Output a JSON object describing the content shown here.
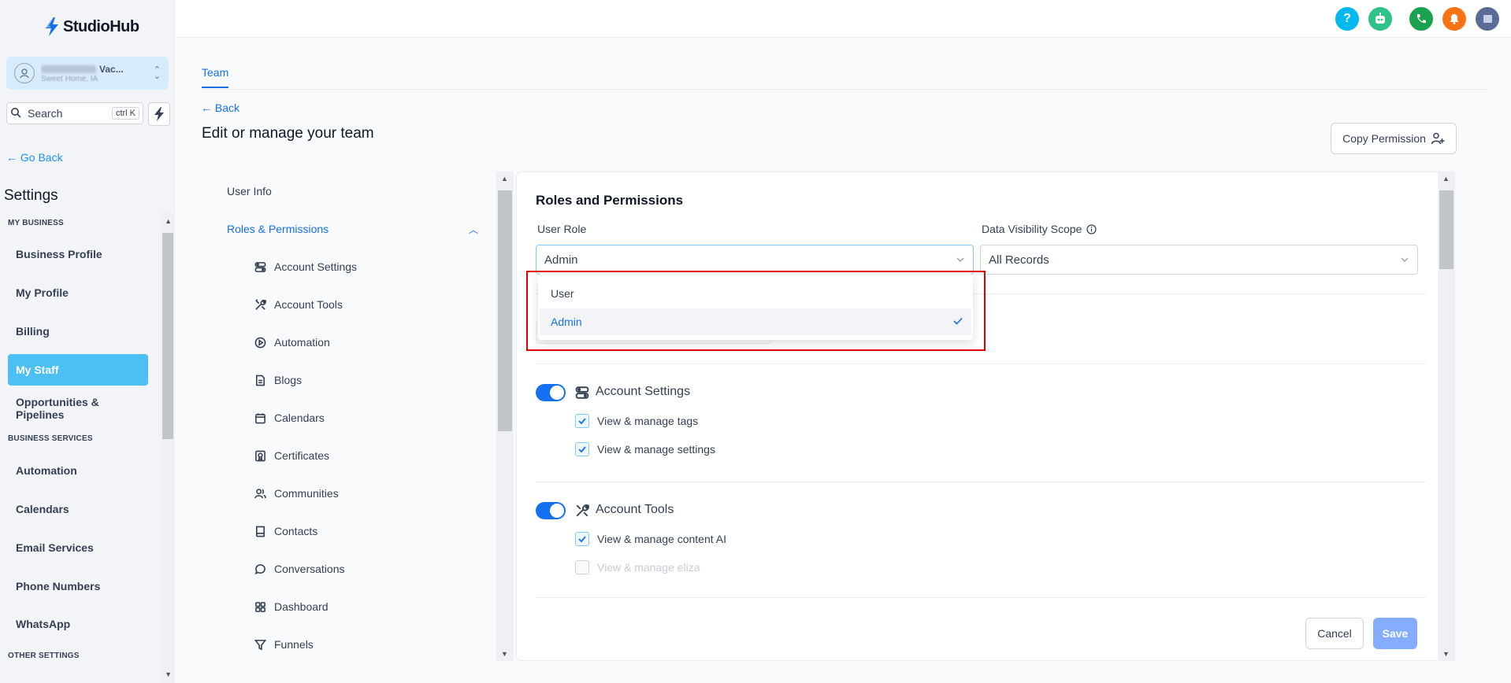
{
  "app": {
    "name": "StudioHub"
  },
  "account": {
    "name_suffix": "Vac...",
    "sub": "Sweet Home, IA"
  },
  "search": {
    "placeholder": "Search",
    "shortcut": "ctrl K"
  },
  "sidebar": {
    "go_back": "Go Back",
    "title": "Settings",
    "sections": [
      {
        "label": "MY BUSINESS"
      },
      {
        "label": "BUSINESS SERVICES"
      },
      {
        "label": "OTHER SETTINGS"
      }
    ],
    "items": [
      {
        "label": "Business Profile"
      },
      {
        "label": "My Profile"
      },
      {
        "label": "Billing"
      },
      {
        "label": "My Staff"
      },
      {
        "label": "Opportunities & Pipelines"
      },
      {
        "label": "Automation"
      },
      {
        "label": "Calendars"
      },
      {
        "label": "Email Services"
      },
      {
        "label": "Phone Numbers"
      },
      {
        "label": "WhatsApp"
      }
    ]
  },
  "topbar": {
    "help": "?",
    "colors": {
      "help": "#00b8f0",
      "bot": "#2fc38a",
      "phone": "#1aa24e",
      "bell": "#f97316",
      "avatar": "#5b6b9a"
    }
  },
  "main": {
    "tab": "Team",
    "back": "Back",
    "title": "Edit or manage your team",
    "copy_permission": "Copy Permission"
  },
  "subnav": {
    "user_info": "User Info",
    "roles": "Roles & Permissions",
    "items": [
      {
        "label": "Account Settings",
        "icon": "account-settings-icon"
      },
      {
        "label": "Account Tools",
        "icon": "tools-icon"
      },
      {
        "label": "Automation",
        "icon": "play-circle-icon"
      },
      {
        "label": "Blogs",
        "icon": "document-icon"
      },
      {
        "label": "Calendars",
        "icon": "calendar-icon"
      },
      {
        "label": "Certificates",
        "icon": "certificate-icon"
      },
      {
        "label": "Communities",
        "icon": "users-icon"
      },
      {
        "label": "Contacts",
        "icon": "contact-book-icon"
      },
      {
        "label": "Conversations",
        "icon": "chat-bubble-icon"
      },
      {
        "label": "Dashboard",
        "icon": "grid-icon"
      },
      {
        "label": "Funnels",
        "icon": "funnel-icon"
      }
    ]
  },
  "panel": {
    "title": "Roles and Permissions",
    "user_role_label": "User Role",
    "user_role_value": "Admin",
    "visibility_label": "Data Visibility Scope",
    "visibility_value": "All Records",
    "dropdown_options": [
      {
        "label": "User",
        "selected": false
      },
      {
        "label": "Admin",
        "selected": true
      }
    ],
    "groups": [
      {
        "title": "Account Settings",
        "enabled": true,
        "permissions": [
          {
            "label": "View & manage tags",
            "checked": true,
            "disabled": false
          },
          {
            "label": "View & manage settings",
            "checked": true,
            "disabled": false
          }
        ]
      },
      {
        "title": "Account Tools",
        "enabled": true,
        "permissions": [
          {
            "label": "View & manage content AI",
            "checked": true,
            "disabled": false
          },
          {
            "label": "View & manage eliza",
            "checked": false,
            "disabled": true
          }
        ]
      }
    ],
    "cancel": "Cancel",
    "save": "Save"
  }
}
